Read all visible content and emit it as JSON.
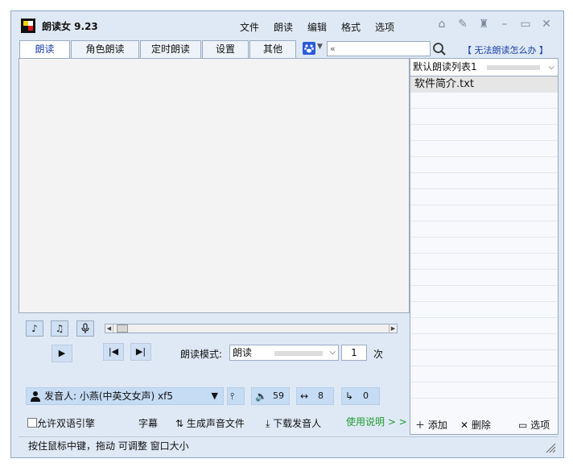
{
  "app": {
    "title": "朗读女 9.23"
  },
  "menu": [
    "文件",
    "朗读",
    "编辑",
    "格式",
    "选项"
  ],
  "titlebar_icons": [
    "home-icon",
    "pin-icon",
    "shirt-icon",
    "minimize-icon",
    "maximize-icon",
    "close-icon"
  ],
  "tabs": [
    {
      "label": "朗读",
      "active": true
    },
    {
      "label": "角色朗读",
      "active": false
    },
    {
      "label": "定时朗读",
      "active": false
    },
    {
      "label": "设置",
      "active": false
    },
    {
      "label": "其他",
      "active": false
    }
  ],
  "search": {
    "value": "«"
  },
  "help_link": "【 无法朗读怎么办 】",
  "playlist": {
    "selected": "默认朗读列表1",
    "files": [
      "软件简介.txt"
    ],
    "add_label": "添加",
    "delete_label": "删除",
    "options_label": "选项"
  },
  "player": {
    "mode_label": "朗读模式:",
    "mode_value": "朗读",
    "repeat_count": "1",
    "repeat_unit": "次"
  },
  "voice": {
    "label": "发音人:",
    "name": "小燕(中英文女声) xf5",
    "volume": "59",
    "speed": "8",
    "pitch": "0"
  },
  "bottom": {
    "bilingual_label": "允许双语引擎",
    "subtitle_label": "字幕",
    "generate_label": "生成声音文件",
    "download_label": "下载发音人",
    "guide_label": "使用说明 > >"
  },
  "status": "按住鼠标中键，拖动 可调整 窗口大小",
  "colors": {
    "link": "#1a3fa8",
    "guide": "#1e9b2e",
    "panel": "#dfe9f5",
    "button": "#cfe0f4"
  }
}
